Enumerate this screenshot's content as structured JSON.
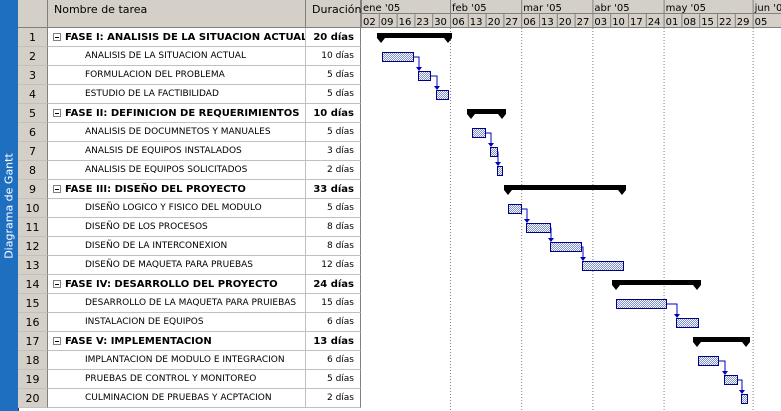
{
  "sidebar": {
    "label": "Diagrama de Gantt",
    "color": "#1f6fc1"
  },
  "table": {
    "headers": {
      "name": "Nombre de tarea",
      "duration": "Duración"
    },
    "rows": [
      {
        "id": "1",
        "name": "FASE I: ANALISIS DE LA SITUACION ACTUAL",
        "duration": "20 días",
        "summary": true
      },
      {
        "id": "2",
        "name": "ANALISIS DE LA SITUACION ACTUAL",
        "duration": "10 días",
        "summary": false
      },
      {
        "id": "3",
        "name": "FORMULACION DEL PROBLEMA",
        "duration": "5 días",
        "summary": false
      },
      {
        "id": "4",
        "name": "ESTUDIO DE LA FACTIBILIDAD",
        "duration": "5 días",
        "summary": false
      },
      {
        "id": "5",
        "name": "FASE II: DEFINICION DE REQUERIMIENTOS",
        "duration": "10 días",
        "summary": true
      },
      {
        "id": "6",
        "name": "ANALISIS DE DOCUMNETOS Y MANUALES",
        "duration": "5 días",
        "summary": false
      },
      {
        "id": "7",
        "name": "ANALSIS DE EQUIPOS INSTALADOS",
        "duration": "3 días",
        "summary": false
      },
      {
        "id": "8",
        "name": "ANALISIS DE EQUIPOS SOLICITADOS",
        "duration": "2 días",
        "summary": false
      },
      {
        "id": "9",
        "name": "FASE III: DISEÑO DEL PROYECTO",
        "duration": "33 días",
        "summary": true
      },
      {
        "id": "10",
        "name": "DISEÑO LOGICO Y FISICO DEL MODULO",
        "duration": "5 días",
        "summary": false
      },
      {
        "id": "11",
        "name": "DISEÑO DE LOS PROCESOS",
        "duration": "8 días",
        "summary": false
      },
      {
        "id": "12",
        "name": "DISEÑO DE LA INTERCONEXION",
        "duration": "8 días",
        "summary": false
      },
      {
        "id": "13",
        "name": "DISEÑO DE MAQUETA PARA PRUEBAS",
        "duration": "12 días",
        "summary": false
      },
      {
        "id": "14",
        "name": "FASE IV: DESARROLLO DEL PROYECTO",
        "duration": "24 días",
        "summary": true
      },
      {
        "id": "15",
        "name": "DESARROLLO DE LA MAQUETA PARA PRUIEBAS",
        "duration": "15 días",
        "summary": false
      },
      {
        "id": "16",
        "name": "INSTALACION DE EQUIPOS",
        "duration": "6 días",
        "summary": false
      },
      {
        "id": "17",
        "name": "FASE V: IMPLEMENTACION",
        "duration": "13 días",
        "summary": true
      },
      {
        "id": "18",
        "name": "IMPLANTACION DE MODULO E INTEGRACION",
        "duration": "6 días",
        "summary": false
      },
      {
        "id": "19",
        "name": "PRUEBAS DE CONTROL Y MONITOREO",
        "duration": "5 días",
        "summary": false
      },
      {
        "id": "20",
        "name": "CULMINACION DE PRUEBAS Y ACPTACION",
        "duration": "2 días",
        "summary": false
      }
    ]
  },
  "timeline": {
    "months": [
      "ene '05",
      "feb '05",
      "mar '05",
      "abr '05",
      "may '05",
      "jun '05"
    ],
    "weeks": [
      "02",
      "09",
      "16",
      "23",
      "30",
      "06",
      "13",
      "20",
      "27",
      "06",
      "13",
      "20",
      "27",
      "03",
      "10",
      "17",
      "24",
      "01",
      "08",
      "15",
      "22",
      "29",
      "05"
    ]
  },
  "colors": {
    "header_bg": "#d4d0c8",
    "summary_bar": "#000000",
    "task_fill": "#7b8fd6",
    "task_border": "#000080",
    "link": "#0000c0"
  }
}
